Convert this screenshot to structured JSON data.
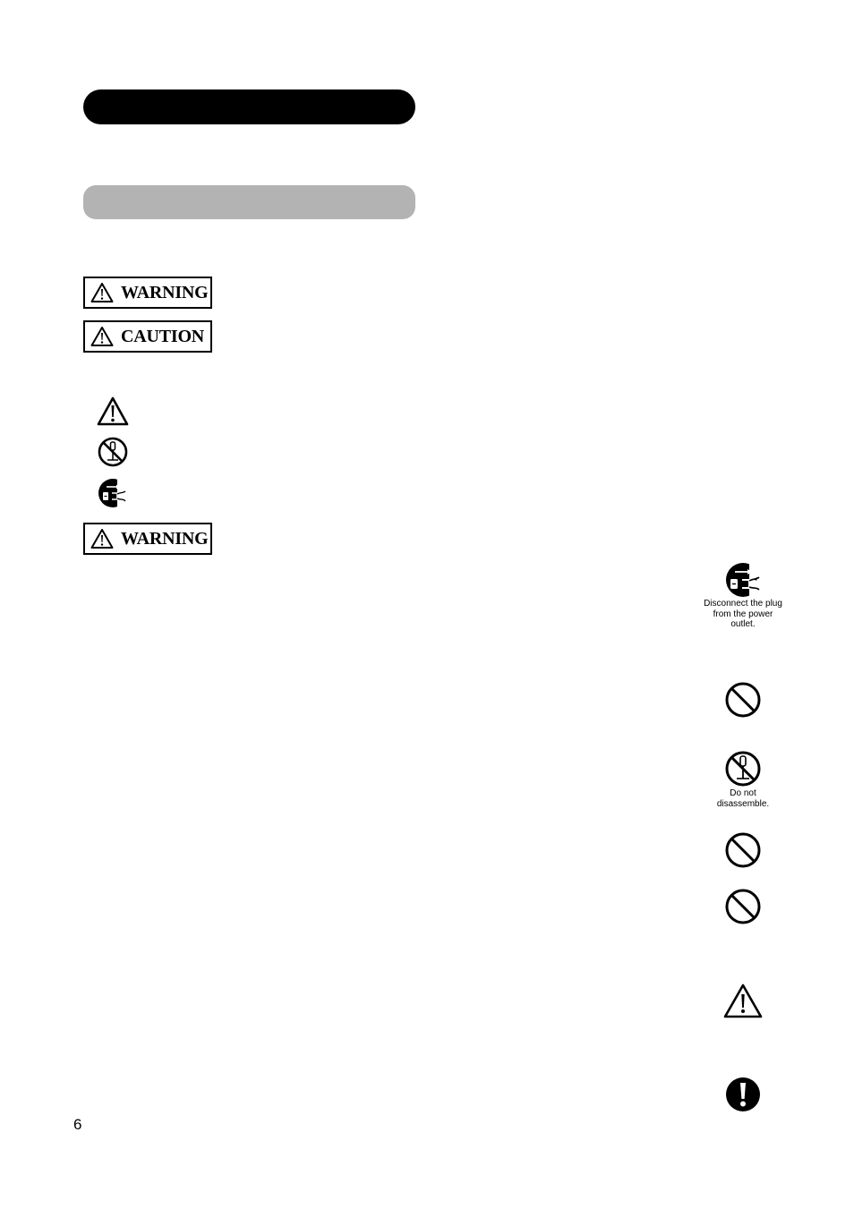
{
  "page": {
    "page_number": "6"
  },
  "headers": {
    "title_bar_color": "#000000",
    "subtitle_bar_color": "#b3b3b3"
  },
  "signal_words": {
    "warning_label": "WARNING",
    "caution_label": "CAUTION",
    "warning_section_label": "WARNING"
  },
  "legend_symbols": [
    {
      "icon": "caution-triangle-icon"
    },
    {
      "icon": "do-not-disassemble-icon"
    },
    {
      "icon": "unplug-icon"
    }
  ],
  "side_symbols": {
    "unplug": {
      "icon": "unplug-icon",
      "caption": "Disconnect the plug from the power outlet."
    },
    "prohibit_1": {
      "icon": "prohibited-icon"
    },
    "disassemble": {
      "icon": "do-not-disassemble-icon",
      "caption": "Do not disassemble."
    },
    "prohibit_2": {
      "icon": "prohibited-icon"
    },
    "prohibit_3": {
      "icon": "prohibited-icon"
    },
    "caution": {
      "icon": "caution-triangle-icon"
    },
    "mandatory": {
      "icon": "mandatory-exclamation-icon"
    }
  }
}
